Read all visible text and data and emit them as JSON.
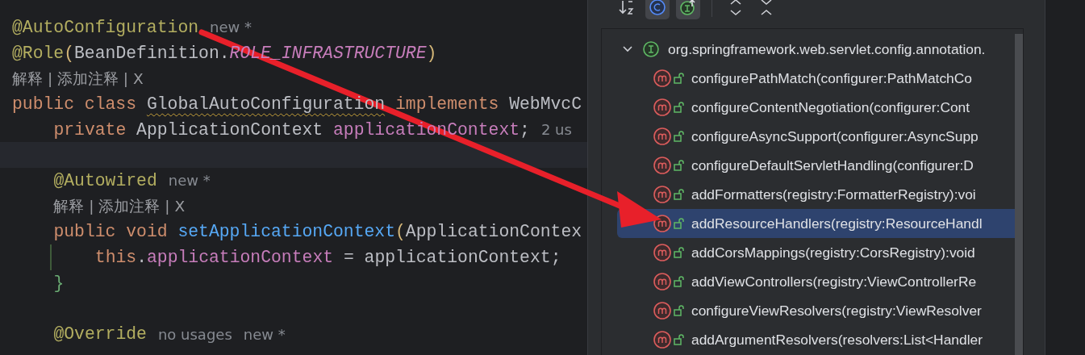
{
  "editor": {
    "lines": [
      {
        "tokens": [
          {
            "text": "@AutoConfiguration",
            "kind": "annotation"
          }
        ],
        "hints": [
          "new *"
        ]
      },
      {
        "tokens": [
          {
            "text": "@Role",
            "kind": "annotation"
          },
          {
            "text": "(",
            "kind": "paren"
          },
          {
            "text": "BeanDefinition.",
            "kind": "plain"
          },
          {
            "text": "ROLE_INFRASTRUCTURE",
            "kind": "static"
          },
          {
            "text": ")",
            "kind": "paren"
          }
        ]
      },
      {
        "lens": "解释 | 添加注释 | X"
      },
      {
        "tokens": [
          {
            "text": "public class ",
            "kind": "keyword"
          },
          {
            "text": "GlobalAutoConfiguration",
            "kind": "warning"
          },
          {
            "text": " implements ",
            "kind": "keyword"
          },
          {
            "text": "WebMvcC",
            "kind": "plain"
          }
        ],
        "children": [
          {
            "tokens": [
              {
                "text": "private ",
                "kind": "keyword"
              },
              {
                "text": "ApplicationContext ",
                "kind": "plain"
              },
              {
                "text": "applicationContext",
                "kind": "field"
              },
              {
                "text": ";",
                "kind": "plain"
              }
            ],
            "hints": [
              "2 us"
            ]
          },
          {
            "current": true
          },
          {
            "tokens": [
              {
                "text": "@Autowired",
                "kind": "annotation"
              }
            ],
            "hints": [
              "new *"
            ]
          },
          {
            "lens": "解释 | 添加注释 | X"
          },
          {
            "tokens": [
              {
                "text": "public void ",
                "kind": "keyword"
              },
              {
                "text": "setApplicationContext",
                "kind": "method"
              },
              {
                "text": "(",
                "kind": "paren"
              },
              {
                "text": "ApplicationContex",
                "kind": "plain"
              }
            ],
            "children": [
              {
                "tokens": [
                  {
                    "text": "this",
                    "kind": "keyword"
                  },
                  {
                    "text": ".",
                    "kind": "plain"
                  },
                  {
                    "text": "applicationContext",
                    "kind": "field"
                  },
                  {
                    "text": " = applicationContext;",
                    "kind": "plain"
                  }
                ]
              }
            ]
          },
          {
            "tokens": [
              {
                "text": "}",
                "kind": "brace"
              }
            ]
          },
          {
            "current": false
          },
          {
            "tokens": [
              {
                "text": "@Override",
                "kind": "annotation"
              }
            ],
            "hints": [
              "no usages",
              "new *"
            ]
          }
        ]
      }
    ]
  },
  "structure_popup": {
    "toolbar": [
      {
        "kind": "sort",
        "selected": false
      },
      {
        "kind": "class",
        "selected": true
      },
      {
        "kind": "inherited",
        "selected": true
      },
      {
        "kind": "expand",
        "selected": false
      },
      {
        "kind": "collapse",
        "selected": false
      }
    ],
    "tree": {
      "label": "org.springframework.web.servlet.config.annotation.",
      "expanded": true,
      "children": [
        {
          "label": "configurePathMatch(configurer:PathMatchCo",
          "selected": false
        },
        {
          "label": "configureContentNegotiation(configurer:Cont",
          "selected": false
        },
        {
          "label": "configureAsyncSupport(configurer:AsyncSupp",
          "selected": false
        },
        {
          "label": "configureDefaultServletHandling(configurer:D",
          "selected": false
        },
        {
          "label": "addFormatters(registry:FormatterRegistry):voi",
          "selected": false
        },
        {
          "label": "addResourceHandlers(registry:ResourceHandl",
          "selected": true
        },
        {
          "label": "addCorsMappings(registry:CorsRegistry):void",
          "selected": false
        },
        {
          "label": "addViewControllers(registry:ViewControllerRe",
          "selected": false
        },
        {
          "label": "configureViewResolvers(registry:ViewResolver",
          "selected": false
        },
        {
          "label": "addArgumentResolvers(resolvers:List<Handler",
          "selected": false
        }
      ]
    }
  }
}
